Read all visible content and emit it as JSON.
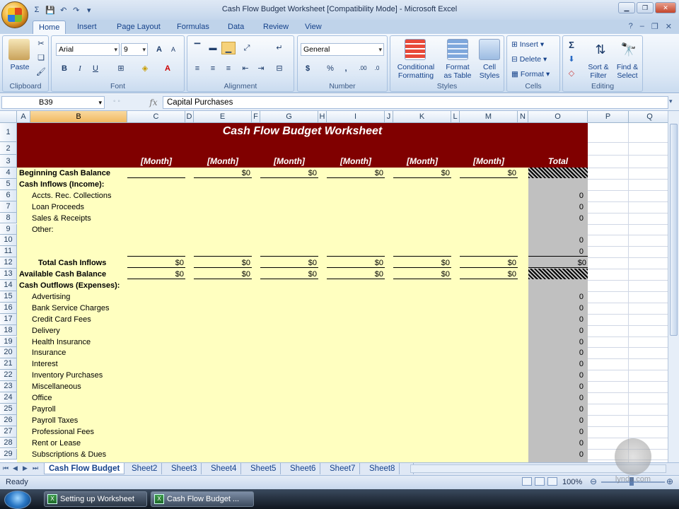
{
  "window": {
    "title": "Cash Flow Budget Worksheet  [Compatibility Mode] - Microsoft Excel"
  },
  "quick_access": {
    "save": "💾",
    "undo": "↶",
    "redo": "↷"
  },
  "tabs": [
    "Home",
    "Insert",
    "Page Layout",
    "Formulas",
    "Data",
    "Review",
    "View"
  ],
  "active_tab": "Home",
  "ribbon": {
    "clipboard": {
      "label": "Clipboard",
      "paste": "Paste"
    },
    "font": {
      "label": "Font",
      "family": "Arial",
      "size": "9",
      "bold": "B",
      "italic": "I",
      "underline": "U",
      "grow": "A",
      "shrink": "A"
    },
    "alignment": {
      "label": "Alignment"
    },
    "number": {
      "label": "Number",
      "format": "General",
      "currency": "$",
      "percent": "%",
      "comma": ","
    },
    "styles": {
      "label": "Styles",
      "conditional": "Conditional",
      "conditional2": "Formatting",
      "format_table": "Format",
      "format_table2": "as Table",
      "cell_styles": "Cell",
      "cell_styles2": "Styles"
    },
    "cells": {
      "label": "Cells",
      "insert": "Insert",
      "delete": "Delete",
      "format": "Format"
    },
    "editing": {
      "label": "Editing",
      "sum": "Σ",
      "sort": "Sort &",
      "sort2": "Filter",
      "find": "Find &",
      "find2": "Select"
    }
  },
  "formula_bar": {
    "name_box": "B39",
    "fx": "fx",
    "content": "Capital Purchases"
  },
  "columns": [
    "A",
    "B",
    "C",
    "D",
    "E",
    "F",
    "G",
    "H",
    "I",
    "J",
    "K",
    "L",
    "M",
    "N",
    "O",
    "P",
    "Q"
  ],
  "rows": [
    "1",
    "2",
    "3",
    "4",
    "5",
    "6",
    "7",
    "8",
    "9",
    "10",
    "11",
    "12",
    "13",
    "14",
    "15",
    "16",
    "17",
    "18",
    "19",
    "20",
    "21",
    "22",
    "23",
    "24",
    "25",
    "26",
    "27",
    "28",
    "29"
  ],
  "sheet": {
    "title": "Cash Flow Budget Worksheet",
    "month_header": "[Month]",
    "total_header": "Total",
    "labels": {
      "r4": "Beginning Cash Balance",
      "r5": "Cash Inflows (Income):",
      "r6": "Accts. Rec. Collections",
      "r7": "Loan Proceeds",
      "r8": "Sales & Receipts",
      "r9": "Other:",
      "r12": "Total Cash Inflows",
      "r13": "Available Cash Balance",
      "r14": "Cash Outflows (Expenses):",
      "r15": "Advertising",
      "r16": "Bank Service Charges",
      "r17": "Credit Card Fees",
      "r18": "Delivery",
      "r19": "Health Insurance",
      "r20": "Insurance",
      "r21": "Interest",
      "r22": "Inventory Purchases",
      "r23": "Miscellaneous",
      "r24": "Office",
      "r25": "Payroll",
      "r26": "Payroll Taxes",
      "r27": "Professional Fees",
      "r28": "Rent or Lease",
      "r29": "Subscriptions & Dues"
    },
    "row4_values": [
      "$0",
      "$0",
      "$0",
      "$0",
      "$0"
    ],
    "row12_values": [
      "$0",
      "$0",
      "$0",
      "$0",
      "$0",
      "$0",
      "$0"
    ],
    "row13_values": [
      "$0",
      "$0",
      "$0",
      "$0",
      "$0",
      "$0"
    ],
    "zero": "0"
  },
  "sheet_tabs": [
    "Cash Flow Budget",
    "Sheet2",
    "Sheet3",
    "Sheet4",
    "Sheet5",
    "Sheet6",
    "Sheet7",
    "Sheet8"
  ],
  "status": {
    "ready": "Ready",
    "zoom": "100%"
  },
  "taskbar": {
    "item1": "Setting up Worksheet",
    "item2": "Cash Flow Budget ..."
  },
  "watermark": "lynda.com",
  "colors": {
    "header_fill": "#800000",
    "body_fill": "#ffffc0",
    "total_fill": "#c0c0c0"
  }
}
